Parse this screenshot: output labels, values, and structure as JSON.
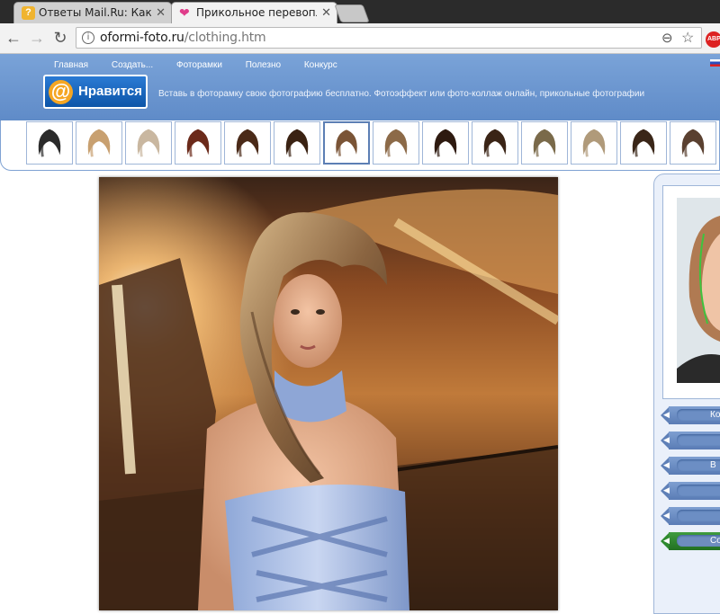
{
  "browser": {
    "tabs": [
      {
        "title": "Ответы Mail.Ru: Какие б",
        "icon": "question-favicon-icon",
        "active": false
      },
      {
        "title": "Прикольное перевопло",
        "icon": "heart-favicon-icon",
        "active": true
      }
    ],
    "url_domain": "oformi-foto.ru",
    "url_path": "/clothing.htm",
    "adblock_label": "ABP"
  },
  "site": {
    "menu": [
      "Главная",
      "Создать...",
      "Фоторамки",
      "Полезно",
      "Конкурс"
    ],
    "like_button_label": "Нравится",
    "like_icon": "@",
    "tagline": "Вставь в фоторамку свою фотографию бесплатно. Фотоэффект или фото-коллаж онлайн, прикольные фотографии"
  },
  "hairstyles": {
    "count": 14,
    "selected_index": 6
  },
  "side_buttons": [
    {
      "label": "Ко",
      "color": "#5f80b7"
    },
    {
      "label": "",
      "color": "#5f80b7"
    },
    {
      "label": "В",
      "color": "#5f80b7"
    },
    {
      "label": "",
      "color": "#5f80b7"
    },
    {
      "label": "",
      "color": "#5f80b7"
    },
    {
      "label": "Сох",
      "color": "#2e8a2e"
    }
  ],
  "colors": {
    "header_blue": "#6b95cf",
    "frame_blue": "#9fb6d8",
    "accent_green": "#2e8a2e"
  }
}
